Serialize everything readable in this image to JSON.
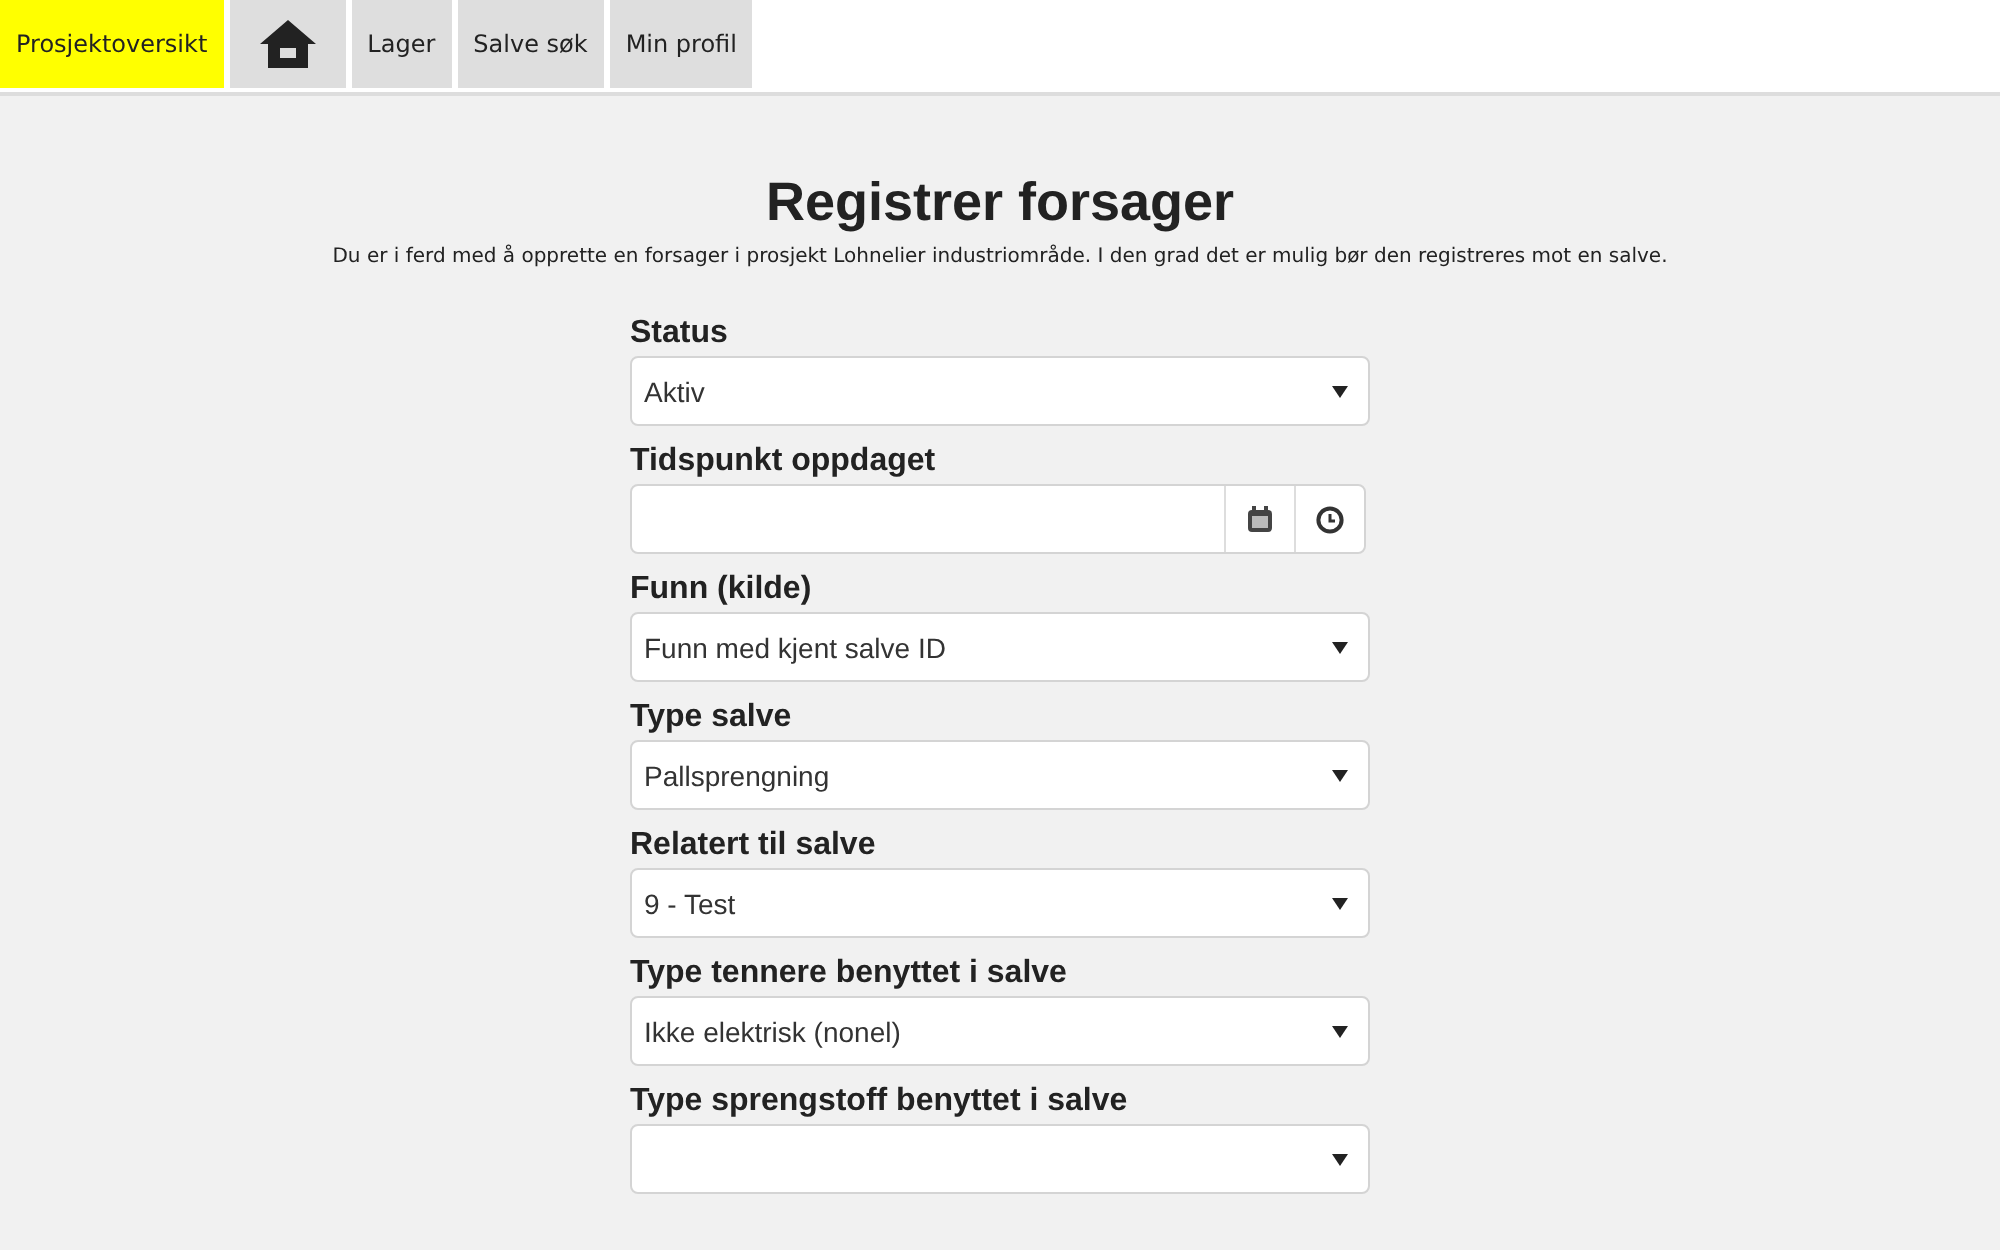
{
  "nav": [
    {
      "kind": "text",
      "label": "Prosjektoversikt",
      "selected": true
    },
    {
      "kind": "icon",
      "selected": false
    },
    {
      "kind": "text",
      "label": "Lager",
      "selected": false
    },
    {
      "kind": "text",
      "label": "Salve søk",
      "selected": false
    },
    {
      "kind": "text",
      "label": "Min profil",
      "selected": false
    }
  ],
  "title": "Registrer forsager",
  "description": "Du er i ferd med å opprette en forsager i prosjekt Lohnelier industriområde. I den grad det er mulig bør den registreres mot en salve.",
  "fields": [
    {
      "kind": "select",
      "label": "Status",
      "value": "Aktiv"
    },
    {
      "kind": "datetime",
      "label": "Tidspunkt oppdaget"
    },
    {
      "kind": "select",
      "label": "Funn (kilde)",
      "value": "Funn med kjent salve ID"
    },
    {
      "kind": "select",
      "label": "Type salve",
      "value": "Pallsprengning"
    },
    {
      "kind": "select",
      "label": "Relatert til salve",
      "value": "9 - Test"
    },
    {
      "kind": "select",
      "label": "Type tennere benyttet i salve",
      "value": "Ikke elektrisk (nonel)"
    },
    {
      "kind": "select",
      "label": "Type sprengstoff benyttet i salve"
    }
  ]
}
